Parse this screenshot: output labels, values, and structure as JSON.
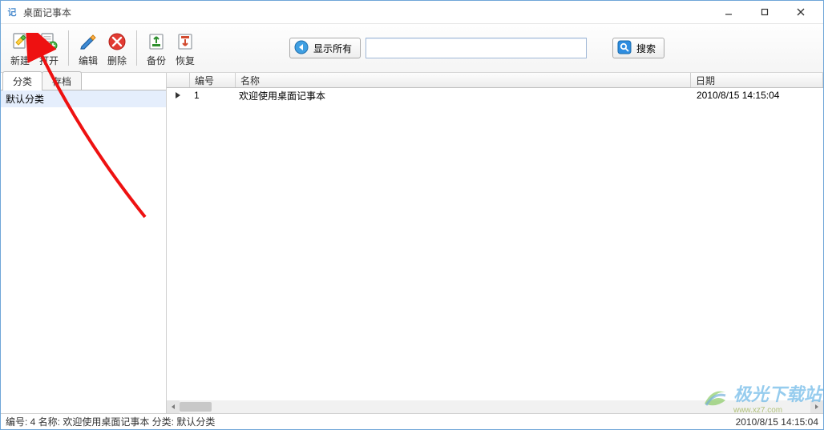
{
  "window": {
    "icon_text": "记",
    "title": "桌面记事本"
  },
  "toolbar": {
    "new_label": "新建",
    "open_label": "打开",
    "edit_label": "编辑",
    "delete_label": "删除",
    "backup_label": "备份",
    "restore_label": "恢复",
    "show_all_label": "显示所有",
    "search_label": "搜索",
    "search_value": ""
  },
  "sidebar": {
    "tabs": [
      {
        "label": "分类",
        "active": true
      },
      {
        "label": "存档",
        "active": false
      }
    ],
    "items": [
      {
        "label": "默认分类",
        "selected": true
      }
    ]
  },
  "list": {
    "columns": {
      "id": "编号",
      "name": "名称",
      "date": "日期"
    },
    "rows": [
      {
        "id": "1",
        "name": "欢迎使用桌面记事本",
        "date": "2010/8/15 14:15:04",
        "current": true
      }
    ]
  },
  "statusbar": {
    "left": "编号: 4  名称: 欢迎使用桌面记事本   分类: 默认分类",
    "right": "2010/8/15 14:15:04"
  },
  "watermark": {
    "text": "极光下载站",
    "sub": "www.xz7.com"
  }
}
